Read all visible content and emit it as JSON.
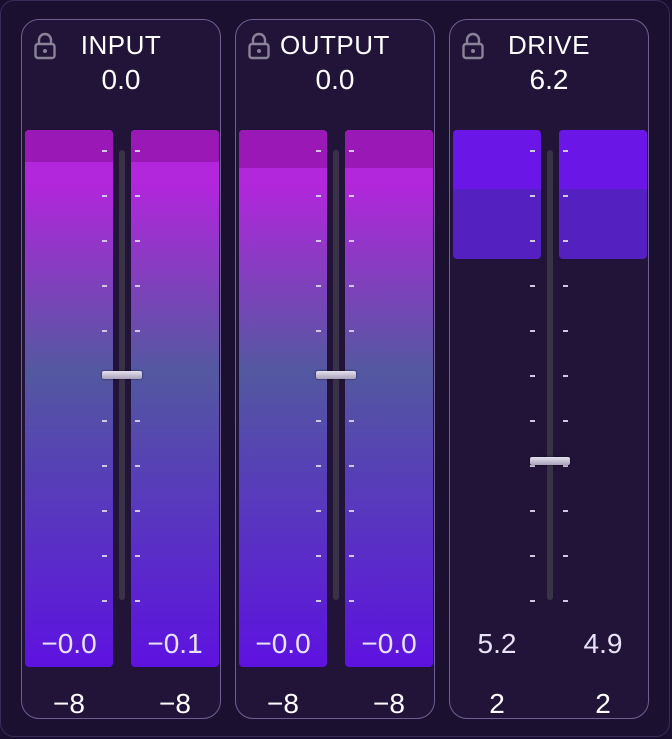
{
  "panels": [
    {
      "id": "input",
      "title": "INPUT",
      "value": "0.0",
      "channels": [
        {
          "reading": "−0.0",
          "bottom": "−8",
          "level": 1.0,
          "peak": 0.06
        },
        {
          "reading": "−0.1",
          "bottom": "−8",
          "level": 1.0,
          "peak": 0.06
        }
      ],
      "fader_position": 0.5,
      "style": "gradient"
    },
    {
      "id": "output",
      "title": "OUTPUT",
      "value": "0.0",
      "channels": [
        {
          "reading": "−0.0",
          "bottom": "−8",
          "level": 1.0,
          "peak": 0.07
        },
        {
          "reading": "−0.0",
          "bottom": "−8",
          "level": 1.0,
          "peak": 0.07
        }
      ],
      "fader_position": 0.5,
      "style": "gradient"
    },
    {
      "id": "drive",
      "title": "DRIVE",
      "value": "6.2",
      "channels": [
        {
          "reading": "5.2",
          "bottom": "2",
          "level": 0.24,
          "peak": 0.11
        },
        {
          "reading": "4.9",
          "bottom": "2",
          "level": 0.24,
          "peak": 0.11
        }
      ],
      "fader_position": 0.69,
      "style": "drive"
    }
  ],
  "colors": {
    "meter_top": "#a21bc4",
    "meter_upper": "#b226dc",
    "meter_mid": "#5358a0",
    "meter_bottom": "#5e12e0",
    "peak_gradient": "#9a18b6",
    "drive_peak": "#6a16e6",
    "drive_body": "#5420c0",
    "panel_border": "#6f5f92"
  },
  "icons": {
    "lock": "lock-icon"
  }
}
